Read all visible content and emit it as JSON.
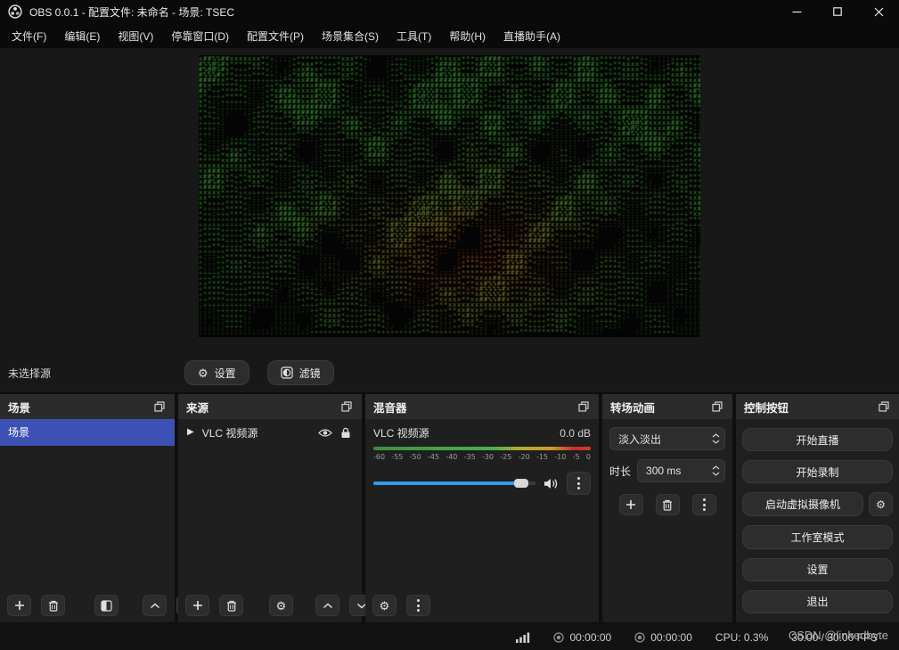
{
  "window": {
    "title": "OBS 0.0.1 - 配置文件: 未命名 - 场景: TSEC"
  },
  "menu": {
    "items": [
      "文件(F)",
      "编辑(E)",
      "视图(V)",
      "停靠窗口(D)",
      "配置文件(P)",
      "场景集合(S)",
      "工具(T)",
      "帮助(H)",
      "直播助手(A)"
    ]
  },
  "source_toolbar": {
    "no_source_label": "未选择源",
    "properties_button": "设置",
    "filters_button": "滤镜"
  },
  "docks": {
    "scenes": {
      "title": "场景",
      "items": [
        {
          "label": "场景",
          "selected": true
        }
      ]
    },
    "sources": {
      "title": "来源",
      "items": [
        {
          "label": "VLC 视频源",
          "visible": true,
          "locked": true
        }
      ]
    },
    "mixer": {
      "title": "混音器",
      "channel": {
        "name": "VLC 视频源",
        "volume_db": "0.0 dB",
        "scale_ticks": [
          "-60",
          "-55",
          "-50",
          "-45",
          "-40",
          "-35",
          "-30",
          "-25",
          "-20",
          "-15",
          "-10",
          "-5",
          "0"
        ],
        "slider_percent": 91,
        "muted": false
      }
    },
    "transitions": {
      "title": "转场动画",
      "current_transition": "淡入淡出",
      "duration_label": "时长",
      "duration_value": "300 ms"
    },
    "controls": {
      "title": "控制按钮",
      "start_streaming": "开始直播",
      "start_recording": "开始录制",
      "virtual_camera": "启动虚拟摄像机",
      "studio_mode": "工作室模式",
      "settings": "设置",
      "exit": "退出"
    }
  },
  "statusbar": {
    "stream_time": "00:00:00",
    "rec_time": "00:00:00",
    "cpu": "CPU: 0.3%",
    "fps": "30.00 / 30.00 FPS",
    "watermark": "CSDN @linkedbyte"
  },
  "icons": {
    "gear": "⚙",
    "play": "▶"
  },
  "colors": {
    "selection_blue": "#3d51b5",
    "slider_blue": "#2f9ceb",
    "meter_green": "#4caf50",
    "meter_yellow": "#c8a82b",
    "meter_red": "#c62f2f"
  }
}
